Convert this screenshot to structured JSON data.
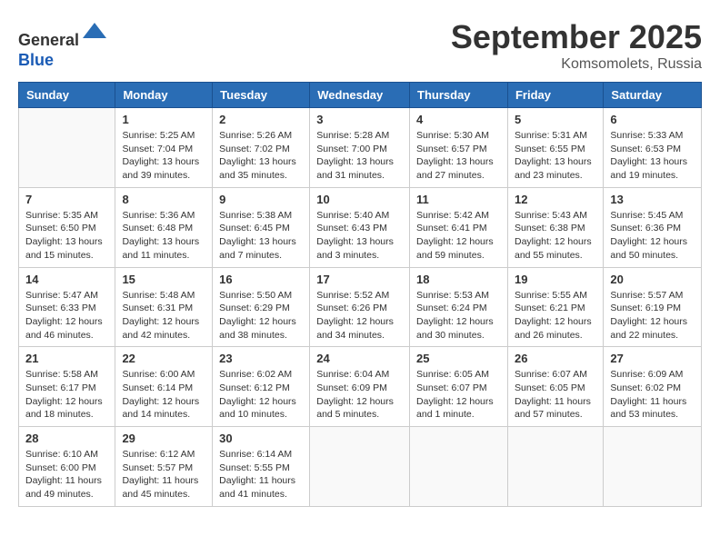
{
  "header": {
    "logo_line1": "General",
    "logo_line2": "Blue",
    "month": "September 2025",
    "location": "Komsomolets, Russia"
  },
  "days_of_week": [
    "Sunday",
    "Monday",
    "Tuesday",
    "Wednesday",
    "Thursday",
    "Friday",
    "Saturday"
  ],
  "weeks": [
    [
      {
        "day": "",
        "info": ""
      },
      {
        "day": "1",
        "info": "Sunrise: 5:25 AM\nSunset: 7:04 PM\nDaylight: 13 hours\nand 39 minutes."
      },
      {
        "day": "2",
        "info": "Sunrise: 5:26 AM\nSunset: 7:02 PM\nDaylight: 13 hours\nand 35 minutes."
      },
      {
        "day": "3",
        "info": "Sunrise: 5:28 AM\nSunset: 7:00 PM\nDaylight: 13 hours\nand 31 minutes."
      },
      {
        "day": "4",
        "info": "Sunrise: 5:30 AM\nSunset: 6:57 PM\nDaylight: 13 hours\nand 27 minutes."
      },
      {
        "day": "5",
        "info": "Sunrise: 5:31 AM\nSunset: 6:55 PM\nDaylight: 13 hours\nand 23 minutes."
      },
      {
        "day": "6",
        "info": "Sunrise: 5:33 AM\nSunset: 6:53 PM\nDaylight: 13 hours\nand 19 minutes."
      }
    ],
    [
      {
        "day": "7",
        "info": "Sunrise: 5:35 AM\nSunset: 6:50 PM\nDaylight: 13 hours\nand 15 minutes."
      },
      {
        "day": "8",
        "info": "Sunrise: 5:36 AM\nSunset: 6:48 PM\nDaylight: 13 hours\nand 11 minutes."
      },
      {
        "day": "9",
        "info": "Sunrise: 5:38 AM\nSunset: 6:45 PM\nDaylight: 13 hours\nand 7 minutes."
      },
      {
        "day": "10",
        "info": "Sunrise: 5:40 AM\nSunset: 6:43 PM\nDaylight: 13 hours\nand 3 minutes."
      },
      {
        "day": "11",
        "info": "Sunrise: 5:42 AM\nSunset: 6:41 PM\nDaylight: 12 hours\nand 59 minutes."
      },
      {
        "day": "12",
        "info": "Sunrise: 5:43 AM\nSunset: 6:38 PM\nDaylight: 12 hours\nand 55 minutes."
      },
      {
        "day": "13",
        "info": "Sunrise: 5:45 AM\nSunset: 6:36 PM\nDaylight: 12 hours\nand 50 minutes."
      }
    ],
    [
      {
        "day": "14",
        "info": "Sunrise: 5:47 AM\nSunset: 6:33 PM\nDaylight: 12 hours\nand 46 minutes."
      },
      {
        "day": "15",
        "info": "Sunrise: 5:48 AM\nSunset: 6:31 PM\nDaylight: 12 hours\nand 42 minutes."
      },
      {
        "day": "16",
        "info": "Sunrise: 5:50 AM\nSunset: 6:29 PM\nDaylight: 12 hours\nand 38 minutes."
      },
      {
        "day": "17",
        "info": "Sunrise: 5:52 AM\nSunset: 6:26 PM\nDaylight: 12 hours\nand 34 minutes."
      },
      {
        "day": "18",
        "info": "Sunrise: 5:53 AM\nSunset: 6:24 PM\nDaylight: 12 hours\nand 30 minutes."
      },
      {
        "day": "19",
        "info": "Sunrise: 5:55 AM\nSunset: 6:21 PM\nDaylight: 12 hours\nand 26 minutes."
      },
      {
        "day": "20",
        "info": "Sunrise: 5:57 AM\nSunset: 6:19 PM\nDaylight: 12 hours\nand 22 minutes."
      }
    ],
    [
      {
        "day": "21",
        "info": "Sunrise: 5:58 AM\nSunset: 6:17 PM\nDaylight: 12 hours\nand 18 minutes."
      },
      {
        "day": "22",
        "info": "Sunrise: 6:00 AM\nSunset: 6:14 PM\nDaylight: 12 hours\nand 14 minutes."
      },
      {
        "day": "23",
        "info": "Sunrise: 6:02 AM\nSunset: 6:12 PM\nDaylight: 12 hours\nand 10 minutes."
      },
      {
        "day": "24",
        "info": "Sunrise: 6:04 AM\nSunset: 6:09 PM\nDaylight: 12 hours\nand 5 minutes."
      },
      {
        "day": "25",
        "info": "Sunrise: 6:05 AM\nSunset: 6:07 PM\nDaylight: 12 hours\nand 1 minute."
      },
      {
        "day": "26",
        "info": "Sunrise: 6:07 AM\nSunset: 6:05 PM\nDaylight: 11 hours\nand 57 minutes."
      },
      {
        "day": "27",
        "info": "Sunrise: 6:09 AM\nSunset: 6:02 PM\nDaylight: 11 hours\nand 53 minutes."
      }
    ],
    [
      {
        "day": "28",
        "info": "Sunrise: 6:10 AM\nSunset: 6:00 PM\nDaylight: 11 hours\nand 49 minutes."
      },
      {
        "day": "29",
        "info": "Sunrise: 6:12 AM\nSunset: 5:57 PM\nDaylight: 11 hours\nand 45 minutes."
      },
      {
        "day": "30",
        "info": "Sunrise: 6:14 AM\nSunset: 5:55 PM\nDaylight: 11 hours\nand 41 minutes."
      },
      {
        "day": "",
        "info": ""
      },
      {
        "day": "",
        "info": ""
      },
      {
        "day": "",
        "info": ""
      },
      {
        "day": "",
        "info": ""
      }
    ]
  ]
}
